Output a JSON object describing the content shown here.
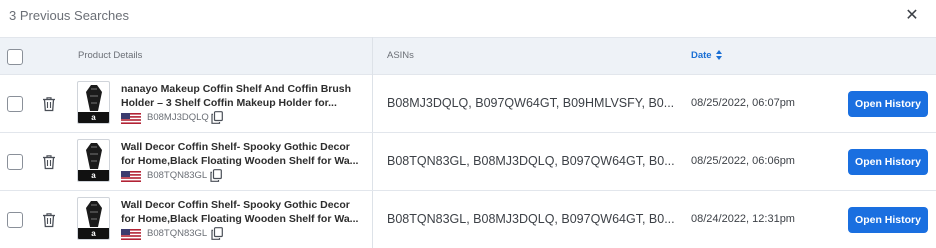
{
  "header": {
    "title": "3 Previous Searches",
    "close_icon": "close-icon"
  },
  "table": {
    "columns": {
      "product": "Product Details",
      "asins": "ASINs",
      "date": "Date"
    },
    "sort_icon": "sort-icon",
    "rows": [
      {
        "title": "nanayo Makeup Coffin Shelf And Coffin Brush\nHolder – 3 Shelf Coffin Makeup Holder for...",
        "asin": "B08MJ3DQLQ",
        "asins": "B08MJ3DQLQ, B097QW64GT, B09HMLVSFY, B0...",
        "date": "08/25/2022, 06:07pm",
        "button": "Open History"
      },
      {
        "title": "Wall Decor Coffin Shelf- Spooky Gothic Decor\nfor Home,Black Floating Wooden Shelf for Wa...",
        "asin": "B08TQN83GL",
        "asins": "B08TQN83GL, B08MJ3DQLQ, B097QW64GT, B0...",
        "date": "08/25/2022, 06:06pm",
        "button": "Open History"
      },
      {
        "title": "Wall Decor Coffin Shelf- Spooky Gothic Decor\nfor Home,Black Floating Wooden Shelf for Wa...",
        "asin": "B08TQN83GL",
        "asins": "B08TQN83GL, B08MJ3DQLQ, B097QW64GT, B0...",
        "date": "08/24/2022, 12:31pm",
        "button": "Open History"
      }
    ]
  },
  "colors": {
    "accent": "#1a6fe0",
    "header_bg": "#eef2f7"
  },
  "thumbnail_badge": "a"
}
